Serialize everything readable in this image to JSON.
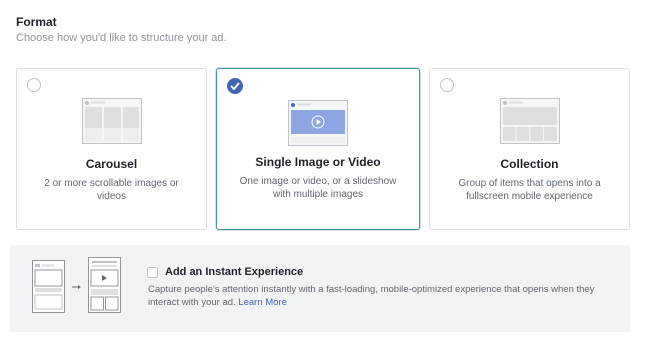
{
  "format": {
    "title": "Format",
    "subtitle": "Choose how you'd like to structure your ad."
  },
  "cards": [
    {
      "name": "Carousel",
      "description": "2 or more scrollable images or videos",
      "selected": false
    },
    {
      "name": "Single Image or Video",
      "description": "One image or video, or a slideshow with multiple images",
      "selected": true
    },
    {
      "name": "Collection",
      "description": "Group of items that opens into a fullscreen mobile experience",
      "selected": false
    }
  ],
  "instant_experience": {
    "title": "Add an Instant Experience",
    "checked": false,
    "description": "Capture people's attention instantly with a fast-loading, mobile-optimized experience that opens when they interact with your ad.",
    "link": "Learn More"
  },
  "colors": {
    "accent": "#4267b2",
    "selected_border": "#4a90a4",
    "panel_bg": "#f2f3f5"
  }
}
